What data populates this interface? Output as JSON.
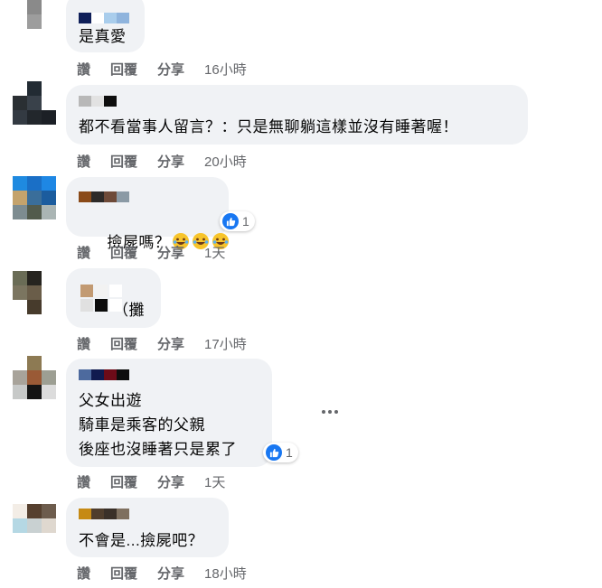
{
  "actions": {
    "like": "讚",
    "reply": "回覆",
    "share": "分享"
  },
  "comments": [
    {
      "text": "是真愛",
      "time": "16小時",
      "avatar_colors": [
        "#3c4246",
        "#b9bdaf",
        "#3c4246",
        "#ffffff",
        "#8a8a8a",
        "#ffffff",
        "#ffffff",
        "#9d9d9d",
        "#ffffff"
      ],
      "name_colors": [
        "#0f1f59",
        "#ffffff",
        "#a9cdec",
        "#8fb4dd"
      ]
    },
    {
      "text": "都不看當事人留言？：只是無聊躺這樣並沒有睡著喔！",
      "time": "20小時",
      "avatar_colors": [
        "#ffffff",
        "#222b33",
        "#ffffff",
        "#2a2f33",
        "#39414a",
        "#ffffff",
        "#333a42",
        "#22272c",
        "#1c2026"
      ],
      "name_colors": [
        "#b8b8b8",
        "#e2e2e2",
        "#0e0e0e"
      ]
    },
    {
      "text": "撿屍嗎？",
      "time": "1天",
      "reaction_count": "1",
      "avatar_colors": [
        "#1f8ae0",
        "#1a6fc6",
        "#1e87e4",
        "#c4a36c",
        "#3a6e9a",
        "#1b5c9e",
        "#7d8c90",
        "#525b4c",
        "#aab5b4"
      ],
      "name_colors": [
        "#8a4a18",
        "#2d2a28",
        "#6e4a38",
        "#8b9aa5"
      ]
    },
    {
      "text": "\n（攤",
      "time": "17小時",
      "avatar_colors": [
        "#6a6c56",
        "#26241f",
        "#ffffff",
        "#7b7560",
        "#6a5d49",
        "#ffffff",
        "#ffffff",
        "#473b2c",
        "#ffffff"
      ],
      "name_colors": [
        "#ffffff",
        "#d7d9de",
        "#ffffff"
      ],
      "name_colors2": [
        "#c29a72",
        "#f2f2f2",
        "#ffffff"
      ],
      "name_colors3": [
        "#e0e0e0",
        "#0b0b0b",
        "#ffffff"
      ]
    },
    {
      "text": "父女出遊\n騎車是乘客的父親\n後座也沒睡著只是累了",
      "time": "1天",
      "reaction_count": "1",
      "avatar_colors": [
        "#ffffff",
        "#8d7a53",
        "#ffffff",
        "#a8a39a",
        "#9a5a36",
        "#9d9f93",
        "#c7c9c8",
        "#141414",
        "#dcdcdc"
      ],
      "name_colors": [
        "#4d6a9e",
        "#101a4f",
        "#6d0b18",
        "#0d0d0d"
      ]
    },
    {
      "text": "不會是...撿屍吧？",
      "time": "18小時",
      "avatar_colors": [
        "#f3ede6",
        "#56402f",
        "#6d5c4d",
        "#b5d8e4",
        "#c9d1d2",
        "#dfd8cf",
        "#ffffff",
        "#ffffff",
        "#ffffff"
      ],
      "name_colors": [
        "#c68a14",
        "#4f3d2c",
        "#3a3028",
        "#7f705f"
      ]
    }
  ]
}
